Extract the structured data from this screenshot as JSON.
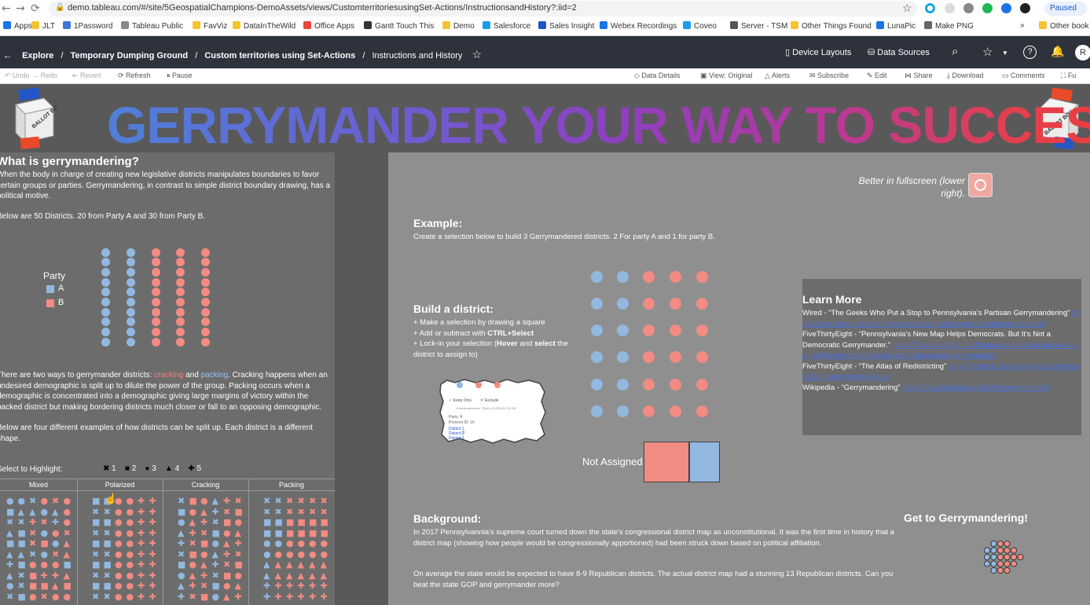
{
  "browser": {
    "url": "demo.tableau.com/#/site/5GeospatialChampions-DemoAssets/views/CustomterritoriesusingSet-Actions/InstructionsandHistory?:iid=2",
    "paused": "Paused",
    "bookmarks": [
      "Apps",
      "JLT",
      "1Password",
      "Tableau Public",
      "FavViz",
      "DataInTheWild",
      "Office Apps",
      "Gantt Touch This",
      "Demo",
      "Salesforce",
      "Sales Insight",
      "Webex Recordings",
      "Coveo",
      "Server - TSM",
      "Other Things Found",
      "LunaPic",
      "Make PNG",
      "Other book"
    ]
  },
  "header": {
    "breadcrumb": [
      "Explore",
      "Temporary Dumping Ground",
      "Custom territories using Set-Actions",
      "Instructions and History"
    ],
    "device_layouts": "Device Layouts",
    "data_sources": "Data Sources",
    "avatar": "R"
  },
  "toolbar": {
    "undo": "Undo",
    "redo": "Redo",
    "revert": "Revert",
    "refresh": "Refresh",
    "pause": "Pause",
    "data_details": "Data Details",
    "view_original": "View: Original",
    "alerts": "Alerts",
    "subscribe": "Subscribe",
    "edit": "Edit",
    "share": "Share",
    "download": "Download",
    "comments": "Comments",
    "full": "Fu"
  },
  "dashboard": {
    "title": "GERRYMANDER YOUR WAY TO SUCCESS",
    "ballot_label": "BALLOT BOX",
    "left": {
      "heading": "What is gerrymandering?",
      "intro": "When the body in charge of creating new legislative districts manipulates boundaries to favor certain groups or parties. Gerrymandering, in contrast to simple district boundary drawing, has a political motive.",
      "fifty": "Below are 50 Districts. 20 from Party A and 30 from Party B.",
      "legend_title": "Party",
      "legend_a": "A",
      "legend_b": "B",
      "ways_1": "There are two ways to gerrymander districts: ",
      "cracking": "cracking",
      "and": " and ",
      "packing": "packing",
      "ways_2": ". Cracking happens when an undesired demographic is split up to dilute the power of the group. Packing occurs when a demographic is concentrated into a demographic giving large margins of victory within the packed district but making bordering districts much closer or fall to an opposing demographic.",
      "four": "Below are four different examples of how districts can be split up. Each district is a different shape.",
      "highlight": "Select to Highlight:",
      "shape_legend": [
        "1",
        "2",
        "3",
        "4",
        "5"
      ],
      "groups": [
        "Mixed",
        "Polarized",
        "Cracking",
        "Packing"
      ]
    },
    "right": {
      "fullscreen": "Better in fullscreen (lower right).",
      "example_h": "Example:",
      "example_t": "Create a selection below to build 3 Gerrymandered districts. 2 For party A and 1 for party B.",
      "build_h": "Build a district:",
      "build_1": "+ Make a selection by drawing a square",
      "build_2a": "+ Add or subtract with ",
      "build_2b": "CTRL+Select",
      "build_3a": "+ Lock-in your selection (",
      "build_3b": "Hover",
      "build_3c": " and ",
      "build_3d": "select",
      "build_3e": " the district to assign to)",
      "tooltip": {
        "keep": "Keep Only",
        "exclude": "Exclude",
        "selected": "8 items selected · SUM of KIDS(X): 20,000",
        "party": "Party: A",
        "precinct": "Precinct ID: 16",
        "d1": "District 1",
        "d2": "District 2",
        "d3": "District 3"
      },
      "not_assigned": "Not Assigned",
      "learn_h": "Learn More",
      "learn_1a": "Wired - “The Geeks Who Put a Stop to Pennsylvania’s Partisan Gerrymandering” ",
      "learn_1b": "https://www.wired.com/story/pennsylvania-partisan-gerrymandering-experts/",
      "learn_2a": "FiveThirtyEight - “Pennsylvania’s New Map Helps Democrats. But It’s Not a Democratic Gerrymander.” ",
      "learn_2b": "https://fivethirtyeight.com/features/pennsylvanias-new-map-helps-democrats-but-its-not-a-democratic-gerrymander/",
      "learn_3a": "FiveThirtyEight - “The Atlas of Redistricting” ",
      "learn_3b": "https://projects.fivethirtyeight.com/redistricting-maps/pennsylvania/",
      "learn_4a": "Wikipedia - “Gerrymandering” ",
      "learn_4b": "https://en.wikipedia.org/wiki/Gerrymandering",
      "bg_h": "Background:",
      "bg_1": "In 2017 Pennsylvannia's supreme court turned down the state's congressional district map as unconstitutional. It was the first time in history that a district map (showing how people would be congressionally apportioned) had been struck down based on political affiliation.",
      "bg_2": "On average the state would be expected to have 8-9 Republican districts. The actual district map had a stunning 13 Republican districts. Can you beat the state GOP and gerrymander more?",
      "cta": "Get to Gerrymandering!"
    },
    "colors": {
      "party_a": "#92b8e0",
      "party_b": "#f28b82"
    }
  }
}
